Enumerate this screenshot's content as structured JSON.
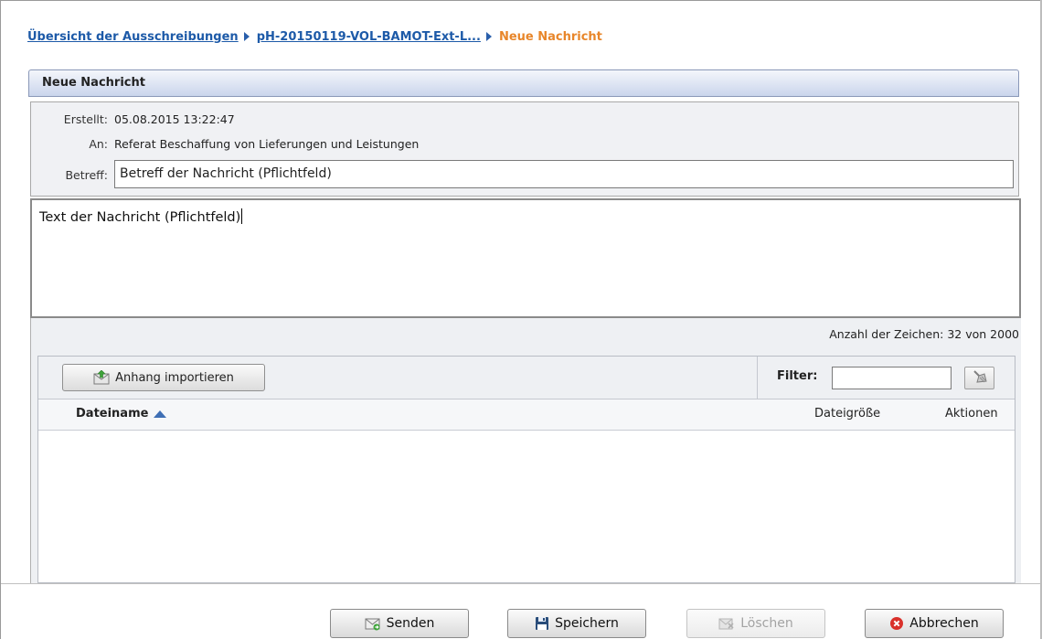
{
  "breadcrumb": {
    "items": [
      "Übersicht der Ausschreibungen",
      "pH-20150119-VOL-BAMOT-Ext-L..."
    ],
    "current": "Neue Nachricht"
  },
  "panel": {
    "title": "Neue Nachricht"
  },
  "meta": {
    "created_label": "Erstellt:",
    "created_value": "05.08.2015 13:22:47",
    "to_label": "An:",
    "to_value": "Referat Beschaffung von Lieferungen und Leistungen",
    "subject_label": "Betreff:",
    "subject_value": "Betreff der Nachricht (Pflichtfeld)"
  },
  "message": {
    "text": "Text der Nachricht (Pflichtfeld)"
  },
  "char_count": "Anzahl der Zeichen: 32 von 2000",
  "attachments": {
    "import_label": "Anhang importieren",
    "filter_label": "Filter:",
    "filter_value": "",
    "columns": [
      "Dateiname",
      "Dateigröße",
      "Aktionen"
    ],
    "sort_column": "Dateiname",
    "sort_direction": "ascending",
    "rows": []
  },
  "actions": {
    "send": "Senden",
    "save": "Speichern",
    "delete": "Löschen",
    "cancel": "Abbrechen"
  },
  "icons": {
    "import": "envelope-import-icon",
    "filter_clear": "broom-icon",
    "send": "envelope-send-icon",
    "save": "floppy-disk-icon",
    "delete": "delete-document-icon",
    "cancel": "red-x-circle-icon"
  },
  "colors": {
    "link": "#1d5aa8",
    "current": "#e8862a",
    "header_gradient_end": "#cad5ec",
    "cancel_icon": "#d9302a"
  }
}
